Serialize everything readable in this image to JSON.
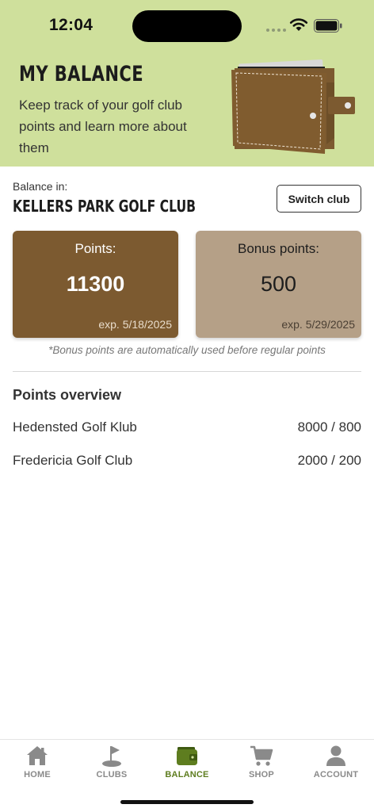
{
  "status_bar": {
    "time": "12:04"
  },
  "header": {
    "title": "MY BALANCE",
    "subtitle": "Keep track of your golf club points and learn more about them"
  },
  "balance": {
    "label": "Balance in:",
    "club_name": "KELLERS PARK GOLF CLUB",
    "switch_label": "Switch club"
  },
  "cards": {
    "points": {
      "label": "Points:",
      "value": "11300",
      "expiry": "exp. 5/18/2025"
    },
    "bonus": {
      "label": "Bonus points:",
      "value": "500",
      "expiry": "exp. 5/29/2025"
    }
  },
  "bonus_note": "*Bonus points are automatically used before regular points",
  "overview": {
    "title": "Points overview",
    "rows": [
      {
        "club": "Hedensted Golf Klub",
        "value": "8000 / 800"
      },
      {
        "club": "Fredericia Golf Club",
        "value": "2000 / 200"
      }
    ]
  },
  "tabs": [
    {
      "label": "HOME",
      "icon": "home-icon"
    },
    {
      "label": "CLUBS",
      "icon": "flag-icon"
    },
    {
      "label": "BALANCE",
      "icon": "wallet-icon",
      "active": true
    },
    {
      "label": "SHOP",
      "icon": "cart-icon"
    },
    {
      "label": "ACCOUNT",
      "icon": "person-icon"
    }
  ],
  "colors": {
    "header_bg": "#cfe09c",
    "points_card": "#7c5a30",
    "bonus_card": "#b5a087",
    "active_tab": "#5e7d1f",
    "inactive_tab": "#8a8a8a"
  }
}
